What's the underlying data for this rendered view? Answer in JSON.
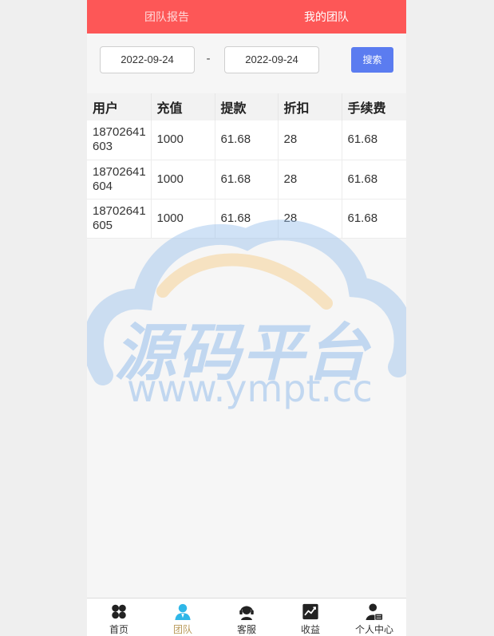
{
  "header": {
    "tabs": [
      {
        "label": "团队报告",
        "active": false
      },
      {
        "label": "我的团队",
        "active": true
      }
    ]
  },
  "filter": {
    "start_date": "2022-09-24",
    "separator": "-",
    "end_date": "2022-09-24",
    "search_label": "搜索"
  },
  "table": {
    "columns": [
      "用户",
      "充值",
      "提款",
      "折扣",
      "手续费"
    ],
    "rows": [
      [
        "18702641603",
        "1000",
        "61.68",
        "28",
        "61.68"
      ],
      [
        "18702641604",
        "1000",
        "61.68",
        "28",
        "61.68"
      ],
      [
        "18702641605",
        "1000",
        "61.68",
        "28",
        "61.68"
      ]
    ]
  },
  "watermark": {
    "title": "源码平台",
    "url": "www.ympt.cc"
  },
  "bottom_nav": {
    "items": [
      {
        "label": "首页",
        "icon": "home-grid-icon",
        "active": false
      },
      {
        "label": "团队",
        "icon": "team-person-icon",
        "active": true
      },
      {
        "label": "客服",
        "icon": "headset-icon",
        "active": false
      },
      {
        "label": "收益",
        "icon": "chart-icon",
        "active": false
      },
      {
        "label": "个人中心",
        "icon": "user-card-icon",
        "active": false
      }
    ]
  },
  "colors": {
    "header_bg": "#fd5757",
    "search_button": "#5b7cf0",
    "active_nav": "#b99a5a",
    "team_icon": "#2fb7e8"
  }
}
